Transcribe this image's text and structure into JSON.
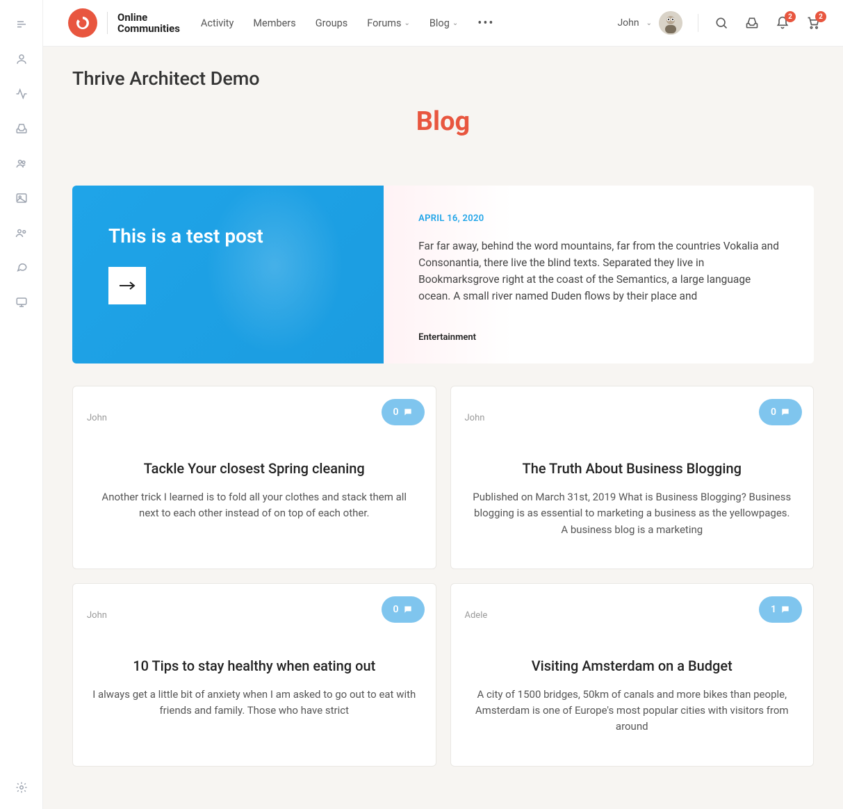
{
  "brand": {
    "name_line1": "Online",
    "name_line2": "Communities"
  },
  "nav": {
    "items": [
      {
        "label": "Activity",
        "dropdown": false
      },
      {
        "label": "Members",
        "dropdown": false
      },
      {
        "label": "Groups",
        "dropdown": false
      },
      {
        "label": "Forums",
        "dropdown": true
      },
      {
        "label": "Blog",
        "dropdown": true
      }
    ]
  },
  "user": {
    "name": "John"
  },
  "badges": {
    "notifications": "2",
    "cart": "2"
  },
  "page": {
    "title": "Thrive Architect Demo",
    "heading": "Blog"
  },
  "featured": {
    "title": "This is a test post",
    "date": "APRIL 16, 2020",
    "excerpt": "Far far away, behind the word mountains, far from the countries Vokalia and Consonantia, there live the blind texts. Separated they live in Bookmarksgrove right at the coast of the Semantics, a large language ocean. A small river named Duden flows by their place and",
    "category": "Entertainment"
  },
  "posts": [
    {
      "author": "John",
      "comments": "0",
      "title": "Tackle Your closest Spring cleaning",
      "excerpt": "Another trick I learned is to fold all your clothes and stack them all next to each other instead of on top of each other."
    },
    {
      "author": "John",
      "comments": "0",
      "title": "The Truth About Business Blogging",
      "excerpt": "Published on March 31st, 2019 What is Business Blogging? Business blogging is as essential to marketing a business as the yellowpages. A business blog is a marketing"
    },
    {
      "author": "John",
      "comments": "0",
      "title": "10 Tips to stay healthy when eating out",
      "excerpt": "I always get a little bit of anxiety when I am asked to go out to eat with friends and family. Those who have strict"
    },
    {
      "author": "Adele",
      "comments": "1",
      "title": "Visiting Amsterdam on a Budget",
      "excerpt": "A city of 1500 bridges, 50km of canals and more bikes than people, Amsterdam is one of Europe's most popular cities with visitors from around"
    }
  ]
}
